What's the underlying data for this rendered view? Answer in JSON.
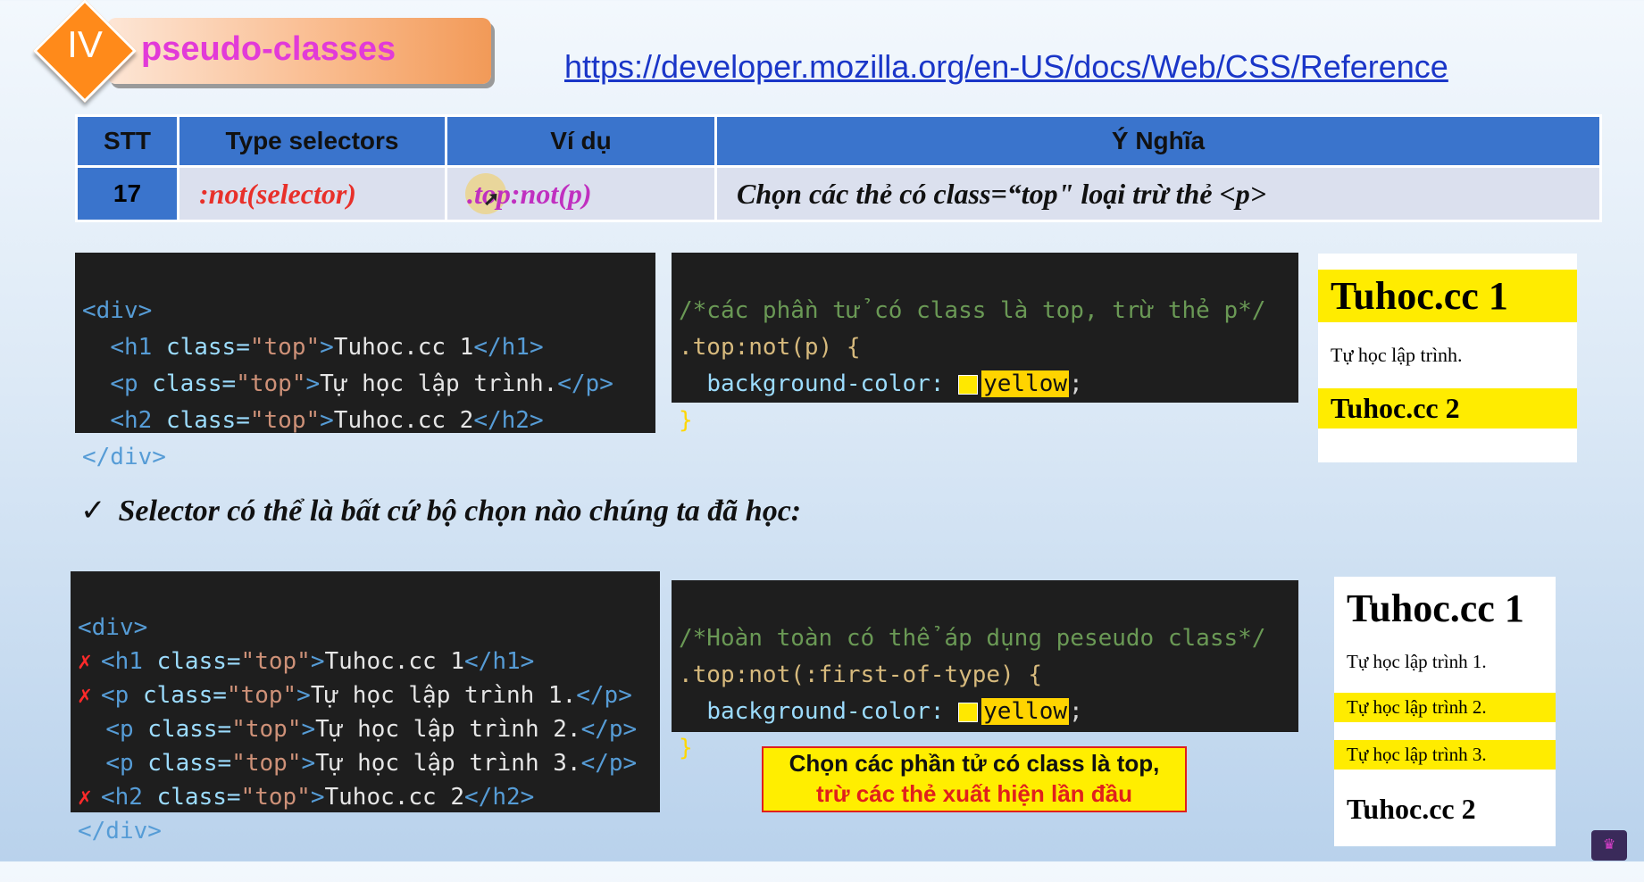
{
  "header": {
    "section_number": "IV",
    "section_title": "pseudo-classes",
    "reference_link": "https://developer.mozilla.org/en-US/docs/Web/CSS/Reference"
  },
  "table": {
    "headers": [
      "STT",
      "Type selectors",
      "Ví dụ",
      "Ý Nghĩa"
    ],
    "row": {
      "stt": "17",
      "selector": ":not(selector)",
      "example": ".top:not(p)",
      "meaning": "Chọn các thẻ có class=“top\" loại trừ thẻ <p>"
    }
  },
  "example1": {
    "html_lines": [
      {
        "open": "<div>"
      },
      {
        "tag": "h1",
        "class": "\"top\"",
        "text": "Tuhoc.cc 1"
      },
      {
        "tag": "p",
        "class": "\"top\"",
        "text": "Tự học lập trình."
      },
      {
        "tag": "h2",
        "class": "\"top\"",
        "text": "Tuhoc.cc 2"
      },
      {
        "close": "</div>"
      }
    ],
    "css_comment": "/*các phần tử có class là top, trừ thẻ p*/",
    "css_selector": ".top:not(p) {",
    "css_property": "background-color:",
    "css_value": "yellow",
    "css_semicolon": ";",
    "css_close": "}",
    "preview": {
      "h1": "Tuhoc.cc 1",
      "p": "Tự học lập trình.",
      "h2": "Tuhoc.cc 2"
    }
  },
  "note": {
    "check": "✓",
    "text": "Selector có thể là bất cứ bộ chọn nào chúng ta đã học:"
  },
  "example2": {
    "lines": {
      "open": "<div>",
      "h1_open": "<h1 ",
      "h1_attr": "class=",
      "h1_val": "\"top\"",
      "h1_text": ">Tuhoc.cc 1</h1>",
      "p1": "Tự học lập trình 1.",
      "p2": "Tự học lập trình 2.",
      "p3": "Tự học lập trình 3.",
      "h2_text": "Tuhoc.cc 2",
      "close": "</div>"
    },
    "x_mark": "✗",
    "css_comment": "/*Hoàn toàn có thể áp dụng peseudo class*/",
    "css_selector": ".top:not(:first-of-type) {",
    "css_property": "background-color:",
    "css_value": "yellow",
    "css_semicolon": ";",
    "css_close": "}",
    "preview": {
      "h1": "Tuhoc.cc 1",
      "p1": "Tự học lập trình 1.",
      "p2": "Tự học lập trình 2.",
      "p3": "Tự học lập trình 3.",
      "h2": "Tuhoc.cc 2"
    }
  },
  "callout": {
    "line1": "Chọn các phần tử có class là top,",
    "line2": "trừ các thẻ xuất hiện lần đầu"
  },
  "colors": {
    "header_blue": "#3a74cc",
    "highlight_yellow": "#ffec00",
    "accent_magenta": "#e23ad8",
    "accent_red": "#e8302a"
  }
}
